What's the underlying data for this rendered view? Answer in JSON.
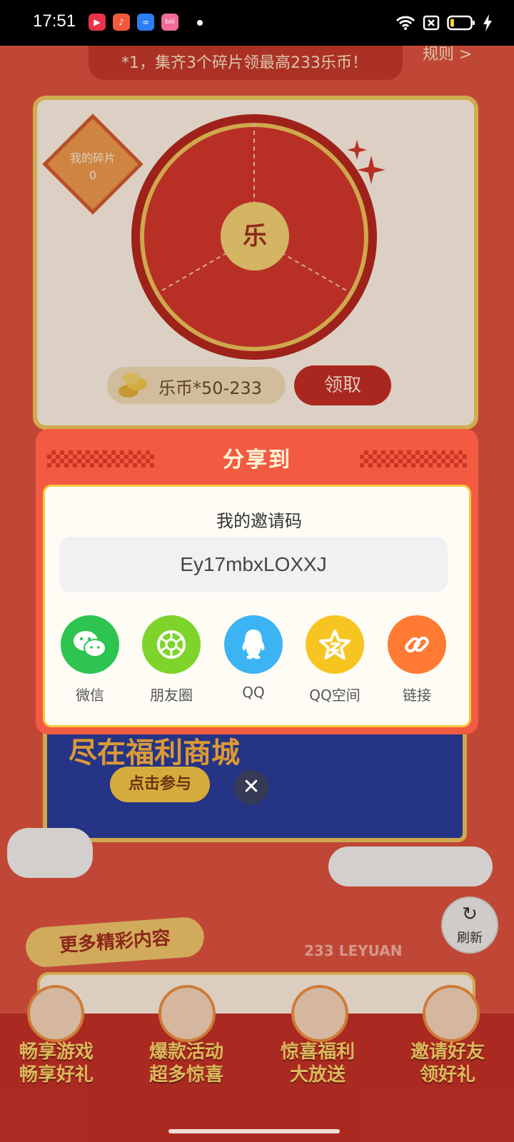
{
  "status_bar": {
    "time": "17:51",
    "apps": [
      "youtube-music-icon",
      "music-icon",
      "infinity-app-icon",
      "bilibili-icon"
    ],
    "right_icons": [
      "wifi-icon",
      "sim-off-icon",
      "battery-icon",
      "charging-icon"
    ]
  },
  "background": {
    "banner_text": "*1，集齐3个碎片领最高233乐币！",
    "rules": "规则 >",
    "fragment_label": "我的碎片",
    "fragment_count": "0",
    "wheel_center": "乐",
    "coin_text": "乐币*50-233",
    "claim_button": "领取",
    "promo_title": "尽在福利商城",
    "promo_button": "点击参与",
    "more_title": "更多精彩内容",
    "leyuan_text": "233 LEYUAN",
    "refresh_label": "刷新",
    "nav": [
      {
        "line1": "畅享游戏",
        "line2": "畅享好礼"
      },
      {
        "line1": "爆款活动",
        "line2": "超多惊喜"
      },
      {
        "line1": "惊喜福利",
        "line2": "大放送"
      },
      {
        "line1": "邀请好友",
        "line2": "领好礼"
      }
    ]
  },
  "share_dialog": {
    "title": "分享到",
    "invite_label": "我的邀请码",
    "invite_code": "Ey17mbxLOXXJ",
    "targets": [
      {
        "label": "微信",
        "icon": "wechat-icon",
        "color": "#2dc44f"
      },
      {
        "label": "朋友圈",
        "icon": "moments-icon",
        "color": "#7ed42a"
      },
      {
        "label": "QQ",
        "icon": "qq-icon",
        "color": "#3cb4f3"
      },
      {
        "label": "QQ空间",
        "icon": "qzone-icon",
        "color": "#f7c522"
      },
      {
        "label": "链接",
        "icon": "link-icon",
        "color": "#ff7a33"
      }
    ],
    "close_icon": "close-icon"
  }
}
